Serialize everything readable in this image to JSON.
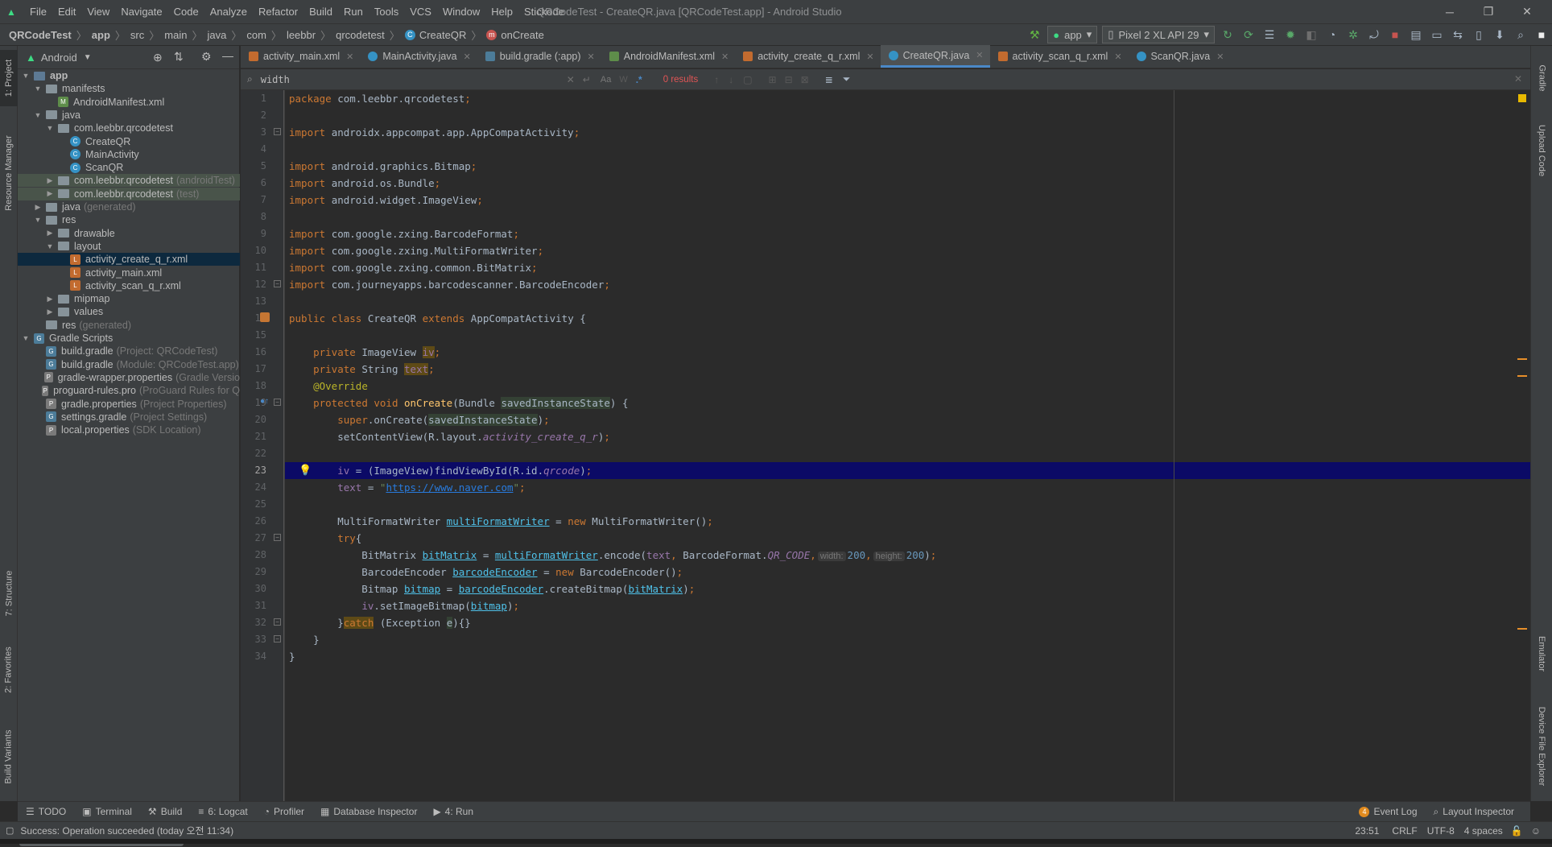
{
  "menu": {
    "items": [
      "File",
      "Edit",
      "View",
      "Navigate",
      "Code",
      "Analyze",
      "Refactor",
      "Build",
      "Run",
      "Tools",
      "VCS",
      "Window",
      "Help",
      "Stickode"
    ],
    "window_title": "QRCodeTest - CreateQR.java [QRCodeTest.app] - Android Studio"
  },
  "breadcrumb": {
    "items": [
      "QRCodeTest",
      "app",
      "src",
      "main",
      "java",
      "com",
      "leebbr",
      "qrcodetest",
      "CreateQR",
      "onCreate"
    ]
  },
  "toolbar": {
    "config": "app",
    "device": "Pixel 2 XL API 29"
  },
  "project": {
    "view": "Android",
    "tree": [
      {
        "label": "app",
        "bold": true,
        "indent": 0,
        "expanded": true,
        "kind": "module"
      },
      {
        "label": "manifests",
        "indent": 1,
        "expanded": true,
        "kind": "folder"
      },
      {
        "label": "AndroidManifest.xml",
        "indent": 2,
        "kind": "manifest"
      },
      {
        "label": "java",
        "indent": 1,
        "expanded": true,
        "kind": "folder"
      },
      {
        "label": "com.leebbr.qrcodetest",
        "indent": 2,
        "expanded": true,
        "kind": "package"
      },
      {
        "label": "CreateQR",
        "indent": 3,
        "kind": "class"
      },
      {
        "label": "MainActivity",
        "indent": 3,
        "kind": "class"
      },
      {
        "label": "ScanQR",
        "indent": 3,
        "kind": "class"
      },
      {
        "label": "com.leebbr.qrcodetest",
        "suffix": "(androidTest)",
        "indent": 2,
        "collapsed": true,
        "kind": "package",
        "green": true
      },
      {
        "label": "com.leebbr.qrcodetest",
        "suffix": "(test)",
        "indent": 2,
        "collapsed": true,
        "kind": "package",
        "green": true
      },
      {
        "label": "java",
        "suffix": "(generated)",
        "indent": 1,
        "collapsed": true,
        "kind": "folder"
      },
      {
        "label": "res",
        "indent": 1,
        "expanded": true,
        "kind": "folder"
      },
      {
        "label": "drawable",
        "indent": 2,
        "collapsed": true,
        "kind": "folder"
      },
      {
        "label": "layout",
        "indent": 2,
        "expanded": true,
        "kind": "folder"
      },
      {
        "label": "activity_create_q_r.xml",
        "indent": 3,
        "kind": "layout",
        "selected": true
      },
      {
        "label": "activity_main.xml",
        "indent": 3,
        "kind": "layout"
      },
      {
        "label": "activity_scan_q_r.xml",
        "indent": 3,
        "kind": "layout"
      },
      {
        "label": "mipmap",
        "indent": 2,
        "collapsed": true,
        "kind": "folder"
      },
      {
        "label": "values",
        "indent": 2,
        "collapsed": true,
        "kind": "folder"
      },
      {
        "label": "res",
        "suffix": "(generated)",
        "indent": 1,
        "kind": "folder"
      },
      {
        "label": "Gradle Scripts",
        "indent": 0,
        "expanded": true,
        "kind": "gradle"
      },
      {
        "label": "build.gradle",
        "suffix": "(Project: QRCodeTest)",
        "indent": 1,
        "kind": "gradle"
      },
      {
        "label": "build.gradle",
        "suffix": "(Module: QRCodeTest.app)",
        "indent": 1,
        "kind": "gradle"
      },
      {
        "label": "gradle-wrapper.properties",
        "suffix": "(Gradle Versio",
        "indent": 1,
        "kind": "props"
      },
      {
        "label": "proguard-rules.pro",
        "suffix": "(ProGuard Rules for Q",
        "indent": 1,
        "kind": "props"
      },
      {
        "label": "gradle.properties",
        "suffix": "(Project Properties)",
        "indent": 1,
        "kind": "props"
      },
      {
        "label": "settings.gradle",
        "suffix": "(Project Settings)",
        "indent": 1,
        "kind": "gradle"
      },
      {
        "label": "local.properties",
        "suffix": "(SDK Location)",
        "indent": 1,
        "kind": "props"
      }
    ]
  },
  "tabs": [
    {
      "label": "activity_main.xml",
      "kind": "layout"
    },
    {
      "label": "MainActivity.java",
      "kind": "class"
    },
    {
      "label": "build.gradle (:app)",
      "kind": "gradle"
    },
    {
      "label": "AndroidManifest.xml",
      "kind": "manifest"
    },
    {
      "label": "activity_create_q_r.xml",
      "kind": "layout"
    },
    {
      "label": "CreateQR.java",
      "kind": "class",
      "active": true
    },
    {
      "label": "activity_scan_q_r.xml",
      "kind": "layout"
    },
    {
      "label": "ScanQR.java",
      "kind": "class"
    }
  ],
  "find": {
    "query": "width",
    "results": "0 results",
    "match_case": "Aa",
    "words": "W",
    "regex": ".*"
  },
  "code": {
    "line_numbers": [
      "1",
      "2",
      "3",
      "4",
      "5",
      "6",
      "7",
      "8",
      "9",
      "10",
      "11",
      "12",
      "13",
      "14",
      "15",
      "16",
      "17",
      "18",
      "19",
      "20",
      "21",
      "22",
      "23",
      "24",
      "25",
      "26",
      "27",
      "28",
      "29",
      "30",
      "31",
      "32",
      "33",
      "34"
    ],
    "current_line": "23",
    "hints": {
      "width": "width:",
      "height": "height:"
    }
  },
  "left_tools": [
    "1: Project",
    "Resource Manager",
    "7: Structure",
    "2: Favorites",
    "Build Variants"
  ],
  "right_tools": [
    "Gradle",
    "Upload Code",
    "Emulator",
    "Device File Explorer"
  ],
  "bottom_tools": [
    "TODO",
    "Terminal",
    "Build",
    "6: Logcat",
    "Profiler",
    "Database Inspector",
    "4: Run"
  ],
  "bottom_right_tools": [
    "Event Log",
    "Layout Inspector"
  ],
  "event_log_count": "4",
  "status": {
    "message": "Success: Operation succeeded (today 오전 11:34)",
    "position": "23:51",
    "line_sep": "CRLF",
    "encoding": "UTF-8",
    "indent": "4 spaces"
  }
}
